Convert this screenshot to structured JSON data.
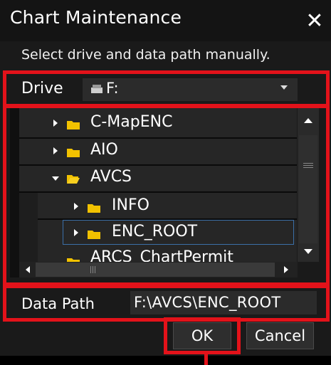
{
  "dialog": {
    "title": "Chart Maintenance",
    "close_glyph": "✕",
    "instruction": "Select drive and data path manually."
  },
  "drive": {
    "label": "Drive",
    "value": "F:",
    "icon": "drive-icon"
  },
  "tree": {
    "items": [
      {
        "label": "C-MapENC",
        "expanded": false,
        "selected": false,
        "level": 1
      },
      {
        "label": "AIO",
        "expanded": false,
        "selected": false,
        "level": 1
      },
      {
        "label": "AVCS",
        "expanded": true,
        "selected": false,
        "level": 1
      },
      {
        "label": "INFO",
        "expanded": false,
        "selected": false,
        "level": 2
      },
      {
        "label": "ENC_ROOT",
        "expanded": false,
        "selected": true,
        "level": 2
      },
      {
        "label": "ARCS_ChartPermit",
        "expanded": false,
        "selected": false,
        "level": 1
      }
    ]
  },
  "data_path": {
    "label": "Data Path",
    "value": "F:\\AVCS\\ENC_ROOT"
  },
  "buttons": {
    "ok": "OK",
    "cancel": "Cancel"
  },
  "colors": {
    "highlight": "#e3121a",
    "folder": "#f2c200",
    "selection_border": "#3b6fa8",
    "background": "#1a1a1a"
  }
}
